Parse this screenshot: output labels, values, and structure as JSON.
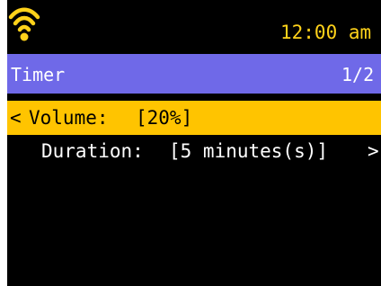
{
  "status": {
    "wifi_icon": "wifi-icon",
    "time": "12:00 am"
  },
  "header": {
    "title": "Timer",
    "page": "1/2"
  },
  "menu": {
    "items": [
      {
        "prefix": "<",
        "label": "Volume:",
        "value": "[20%]",
        "selected": true
      },
      {
        "label": "Duration:",
        "value": "[5 minutes(s)]",
        "suffix": ">",
        "selected": false
      }
    ]
  },
  "colors": {
    "background": "#000000",
    "header": "#6f69e8",
    "selection": "#ffc400",
    "accent": "#ffd21a",
    "text": "#ffffff"
  }
}
